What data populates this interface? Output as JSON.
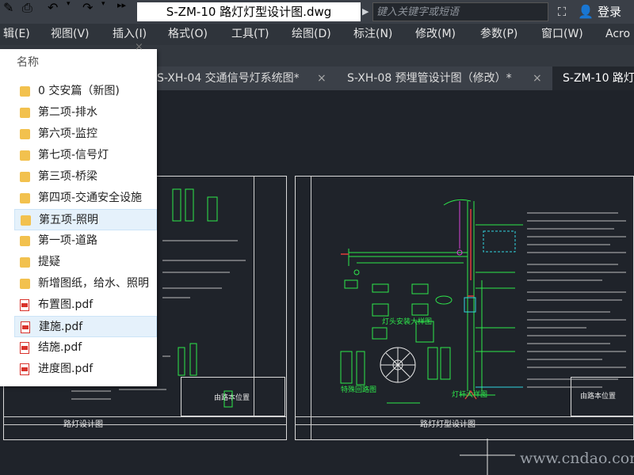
{
  "window": {
    "title": "S-ZM-10 路灯灯型设计图.dwg",
    "search_placeholder": "键入关键字或短语",
    "login_label": "登录"
  },
  "menu": [
    "辑(E)",
    "视图(V)",
    "插入(I)",
    "格式(O)",
    "工具(T)",
    "绘图(D)",
    "标注(N)",
    "修改(M)",
    "参数(P)",
    "窗口(W)",
    "Acro"
  ],
  "tabs": [
    {
      "label": "S-XH-04 交通信号灯系统图*",
      "close": "×"
    },
    {
      "label": "S-XH-08 预埋管设计图（修改）*",
      "close": "×"
    },
    {
      "label": "S-ZM-10 路灯",
      "close": ""
    }
  ],
  "panel": {
    "header": "名称",
    "close_label": "×",
    "items": [
      {
        "label": "0 交安篇（新图)",
        "type": "folder",
        "selected": false
      },
      {
        "label": "第二项-排水",
        "type": "folder",
        "selected": false
      },
      {
        "label": "第六项-监控",
        "type": "folder",
        "selected": false
      },
      {
        "label": "第七项-信号灯",
        "type": "folder",
        "selected": false
      },
      {
        "label": "第三项-桥梁",
        "type": "folder",
        "selected": false
      },
      {
        "label": "第四项-交通安全设施",
        "type": "folder",
        "selected": false
      },
      {
        "label": "第五项-照明",
        "type": "folder",
        "selected": true
      },
      {
        "label": "第一项-道路",
        "type": "folder",
        "selected": false
      },
      {
        "label": "提疑",
        "type": "folder",
        "selected": false
      },
      {
        "label": "新增图纸，给水、照明",
        "type": "folder",
        "selected": false
      },
      {
        "label": "布置图.pdf",
        "type": "pdf",
        "selected": false
      },
      {
        "label": "建施.pdf",
        "type": "pdf",
        "selected": true
      },
      {
        "label": "结施.pdf",
        "type": "pdf",
        "selected": false
      },
      {
        "label": "进度图.pdf",
        "type": "pdf",
        "selected": false
      }
    ]
  },
  "drawing": {
    "sheet_left_title": "路灯设计图",
    "sheet_right_title": "路灯灯型设计图",
    "left_location": "由路本位置",
    "right_location": "由路本位置",
    "detail_1": "特殊回路图",
    "detail_2": "灯头安装大样图",
    "detail_3": "灯杆大样图"
  },
  "watermark": "www.cndao.com",
  "colors": {
    "folder": "#f2c14e",
    "pdf": "#d9322b",
    "selection": "#e5f1fb",
    "cad_green": "#2ee84b",
    "cad_red": "#e03a3a",
    "cad_cyan": "#32d6e0",
    "cad_magenta": "#d844d8"
  }
}
